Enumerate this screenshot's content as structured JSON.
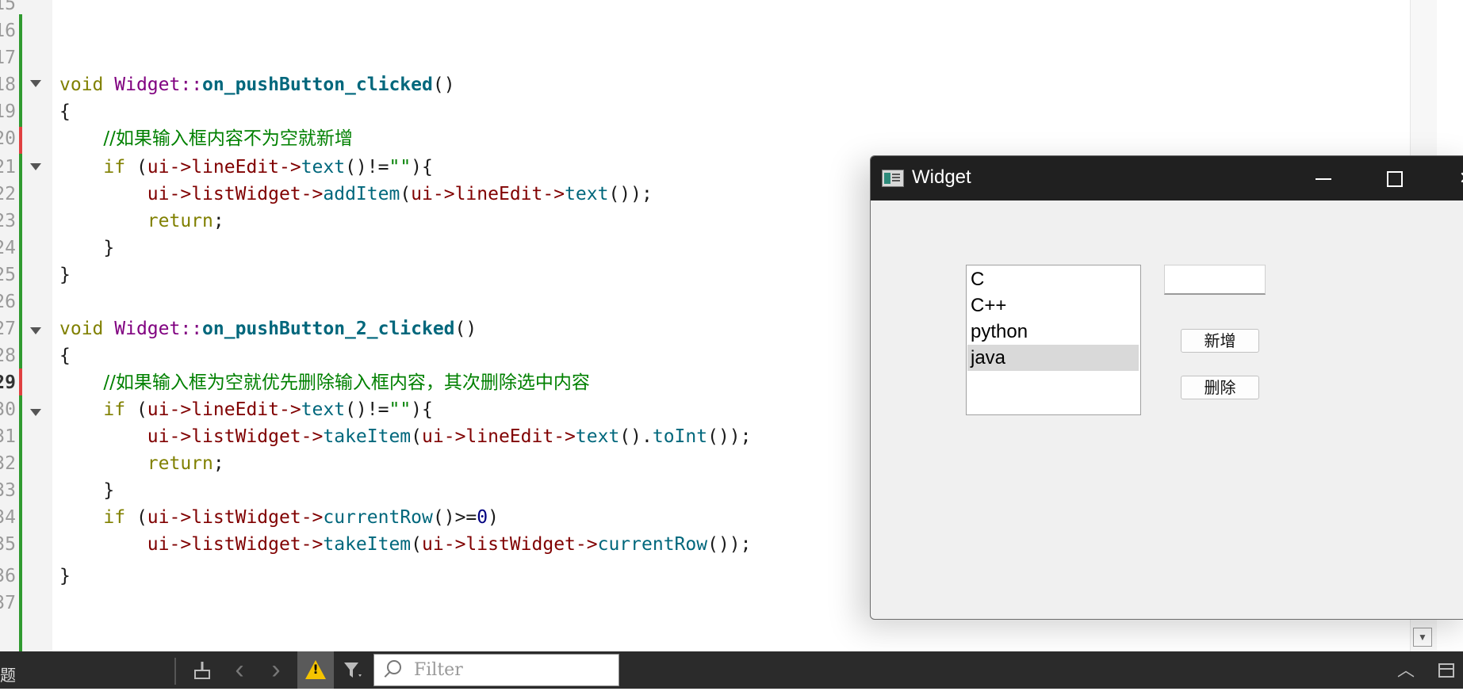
{
  "editor": {
    "line_numbers": [
      "15",
      "16",
      "17",
      "18",
      "19",
      "20",
      "21",
      "22",
      "23",
      "24",
      "25",
      "26",
      "27",
      "28",
      "29",
      "30",
      "31",
      "32",
      "33",
      "34",
      "35",
      "36",
      "37"
    ],
    "current_line": "29",
    "fold_lines": [
      "18",
      "21",
      "27",
      "30"
    ],
    "code": {
      "l18_kw": "void",
      "l18_cls": "Widget",
      "l18_sep": "::",
      "l18_fn": "on_pushButton_clicked",
      "l18_paren": "()",
      "brace_open": "{",
      "brace_close": "}",
      "l20_comment": "//如果输入框内容不为空就新增",
      "l21_if": "if",
      "l21_a": " (",
      "l21_ui": "ui",
      "l21_arrow1": "->",
      "l21_lineEdit": "lineEdit",
      "l21_arrow2": "->",
      "l21_text": "text",
      "l21_rest1": "()!=",
      "l21_str": "\"\"",
      "l21_rest2": "){",
      "l22_ui": "ui",
      "l22_arrow1": "->",
      "l22_listWidget": "listWidget",
      "l22_arrow2": "->",
      "l22_addItem": "addItem",
      "l22_p": "(",
      "l22_ui2": "ui",
      "l22_arrow3": "->",
      "l22_lineEdit": "lineEdit",
      "l22_arrow4": "->",
      "l22_text": "text",
      "l22_end": "());",
      "return_kw": "return",
      "semicolon": ";",
      "l27_fn": "on_pushButton_2_clicked",
      "l29_comment": "//如果输入框为空就优先删除输入框内容，其次删除选中内容",
      "l31_takeItem": "takeItem",
      "l31_toInt": "toInt",
      "l31_end": "());",
      "dot": ".",
      "paren_close": ")",
      "l34_currentRow": "currentRow",
      "l34_cmp": "()>=",
      "l34_num": "0",
      "l35_end": "());"
    }
  },
  "widget_window": {
    "title": "Widget",
    "minimize_glyph": "—",
    "close_glyph": "✕",
    "list_items": [
      "C",
      "C++",
      "python",
      "java"
    ],
    "selected_index": 3,
    "line_edit_value": "",
    "add_button": "新增",
    "delete_button": "删除"
  },
  "bottom_bar": {
    "left_label": "题",
    "filter_placeholder": "Filter",
    "back_glyph": "‹",
    "forward_glyph": "›",
    "collapse_glyph": "︿"
  },
  "colors": {
    "keyword": "#808000",
    "class": "#800080",
    "function": "#00677c",
    "member": "#800000",
    "comment": "#008000",
    "change_bar": "#2f9a2f",
    "titlebar": "#202020"
  }
}
